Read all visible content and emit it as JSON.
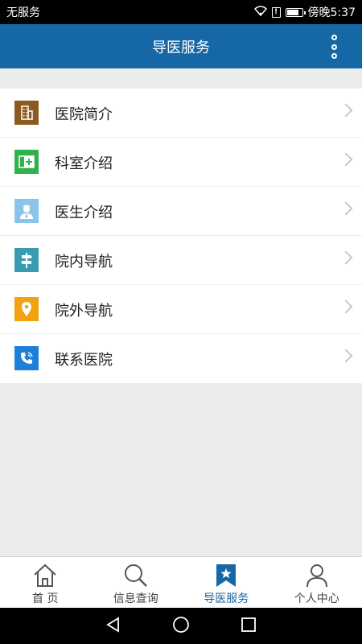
{
  "status_bar": {
    "carrier": "无服务",
    "time": "傍晚5:37",
    "sim_label": "!"
  },
  "header": {
    "title": "导医服务",
    "more_icon": "more-vertical-icon"
  },
  "menu": {
    "items": [
      {
        "label": "医院简介",
        "icon": "hospital-building-icon",
        "color": "#8a5a1e"
      },
      {
        "label": "科室介绍",
        "icon": "department-plus-icon",
        "color": "#2fb24c"
      },
      {
        "label": "医生介绍",
        "icon": "doctor-icon",
        "color": "#89c5ea"
      },
      {
        "label": "院内导航",
        "icon": "signpost-icon",
        "color": "#3a9bb0"
      },
      {
        "label": "院外导航",
        "icon": "location-pin-icon",
        "color": "#f1a20f"
      },
      {
        "label": "联系医院",
        "icon": "phone-call-icon",
        "color": "#1d7fd7"
      }
    ]
  },
  "tabs": [
    {
      "label": "首 页",
      "icon": "home-icon",
      "active": false
    },
    {
      "label": "信息查询",
      "icon": "search-icon",
      "active": false
    },
    {
      "label": "导医服务",
      "icon": "bookmark-star-icon",
      "active": true
    },
    {
      "label": "个人中心",
      "icon": "user-icon",
      "active": false
    }
  ],
  "colors": {
    "primary": "#1667a5",
    "background": "#ececec"
  }
}
